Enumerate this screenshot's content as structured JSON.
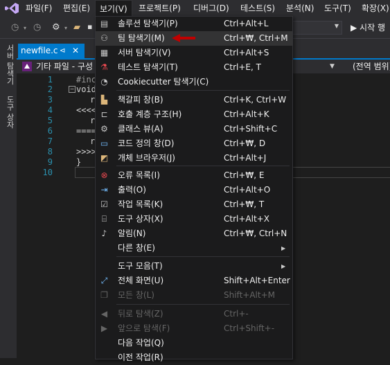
{
  "menubar": {
    "items": [
      "파일(F)",
      "편집(E)",
      "보기(V)",
      "프로젝트(P)",
      "디버그(D)",
      "테스트(S)",
      "분석(N)",
      "도구(T)",
      "확장(X)"
    ],
    "active_index": 2
  },
  "toolbar": {
    "run_label": "▶ 시작 행"
  },
  "side_panel": {
    "server_explorer": "서버 탐색기",
    "toolbox": "도구 상자"
  },
  "tab": {
    "filename": "newfile.c",
    "pin": "⊲",
    "close": "✕"
  },
  "navbar": {
    "project": "기타 파일 - 구성",
    "scope": "(전역 범위)"
  },
  "editor": {
    "line_numbers": [
      "1",
      "2",
      "3",
      "4",
      "5",
      "6",
      "7",
      "8",
      "9",
      "10"
    ],
    "fragments": [
      "#inc",
      "void",
      "r",
      "<<<<",
      "r",
      "====",
      "r",
      ">>>>",
      "}"
    ]
  },
  "view_menu": {
    "items": [
      {
        "label": "솔루션 탐색기(P)",
        "shortcut": "Ctrl+Alt+L",
        "icon": "solution-explorer-icon"
      },
      {
        "label": "팀 탐색기(M)",
        "shortcut": "Ctrl+₩, Ctrl+M",
        "icon": "team-explorer-icon"
      },
      {
        "label": "서버 탐색기(V)",
        "shortcut": "Ctrl+Alt+S",
        "icon": "server-explorer-icon"
      },
      {
        "label": "테스트 탐색기(T)",
        "shortcut": "Ctrl+E, T",
        "icon": "test-explorer-icon"
      },
      {
        "label": "Cookiecutter 탐색기(C)",
        "shortcut": "",
        "icon": "cookiecutter-icon"
      },
      {
        "label": "책갈피 창(B)",
        "shortcut": "Ctrl+K, Ctrl+W",
        "icon": "bookmark-icon"
      },
      {
        "label": "호출 계층 구조(H)",
        "shortcut": "Ctrl+Alt+K",
        "icon": "call-hierarchy-icon"
      },
      {
        "label": "클래스 뷰(A)",
        "shortcut": "Ctrl+Shift+C",
        "icon": "class-view-icon"
      },
      {
        "label": "코드 정의 창(D)",
        "shortcut": "Ctrl+₩, D",
        "icon": "code-definition-icon"
      },
      {
        "label": "개체 브라우저(J)",
        "shortcut": "Ctrl+Alt+J",
        "icon": "object-browser-icon"
      },
      {
        "label": "오류 목록(I)",
        "shortcut": "Ctrl+₩, E",
        "icon": "error-list-icon"
      },
      {
        "label": "출력(O)",
        "shortcut": "Ctrl+Alt+O",
        "icon": "output-icon"
      },
      {
        "label": "작업 목록(K)",
        "shortcut": "Ctrl+₩, T",
        "icon": "task-list-icon"
      },
      {
        "label": "도구 상자(X)",
        "shortcut": "Ctrl+Alt+X",
        "icon": "toolbox-icon"
      },
      {
        "label": "알림(N)",
        "shortcut": "Ctrl+₩, Ctrl+N",
        "icon": "notifications-icon"
      },
      {
        "label": "다른 창(E)",
        "shortcut": "",
        "icon": ""
      },
      {
        "label": "도구 모음(T)",
        "shortcut": "",
        "icon": ""
      },
      {
        "label": "전체 화면(U)",
        "shortcut": "Shift+Alt+Enter",
        "icon": "full-screen-icon"
      },
      {
        "label": "모든 창(L)",
        "shortcut": "Shift+Alt+M",
        "icon": "all-windows-icon"
      },
      {
        "label": "뒤로 탐색(Z)",
        "shortcut": "Ctrl+-",
        "icon": "navigate-back-icon"
      },
      {
        "label": "앞으로 탐색(F)",
        "shortcut": "Ctrl+Shift+-",
        "icon": "navigate-forward-icon"
      },
      {
        "label": "다음 작업(Q)",
        "shortcut": "",
        "icon": ""
      },
      {
        "label": "이전 작업(R)",
        "shortcut": "",
        "icon": ""
      }
    ],
    "highlighted_index": 1,
    "disabled_indexes": [
      18,
      19,
      20
    ]
  },
  "colors": {
    "accent": "#007acc",
    "annotation_arrow": "#c00000",
    "menu_bg": "#1b1b1c",
    "chrome_bg": "#2d2d30"
  }
}
